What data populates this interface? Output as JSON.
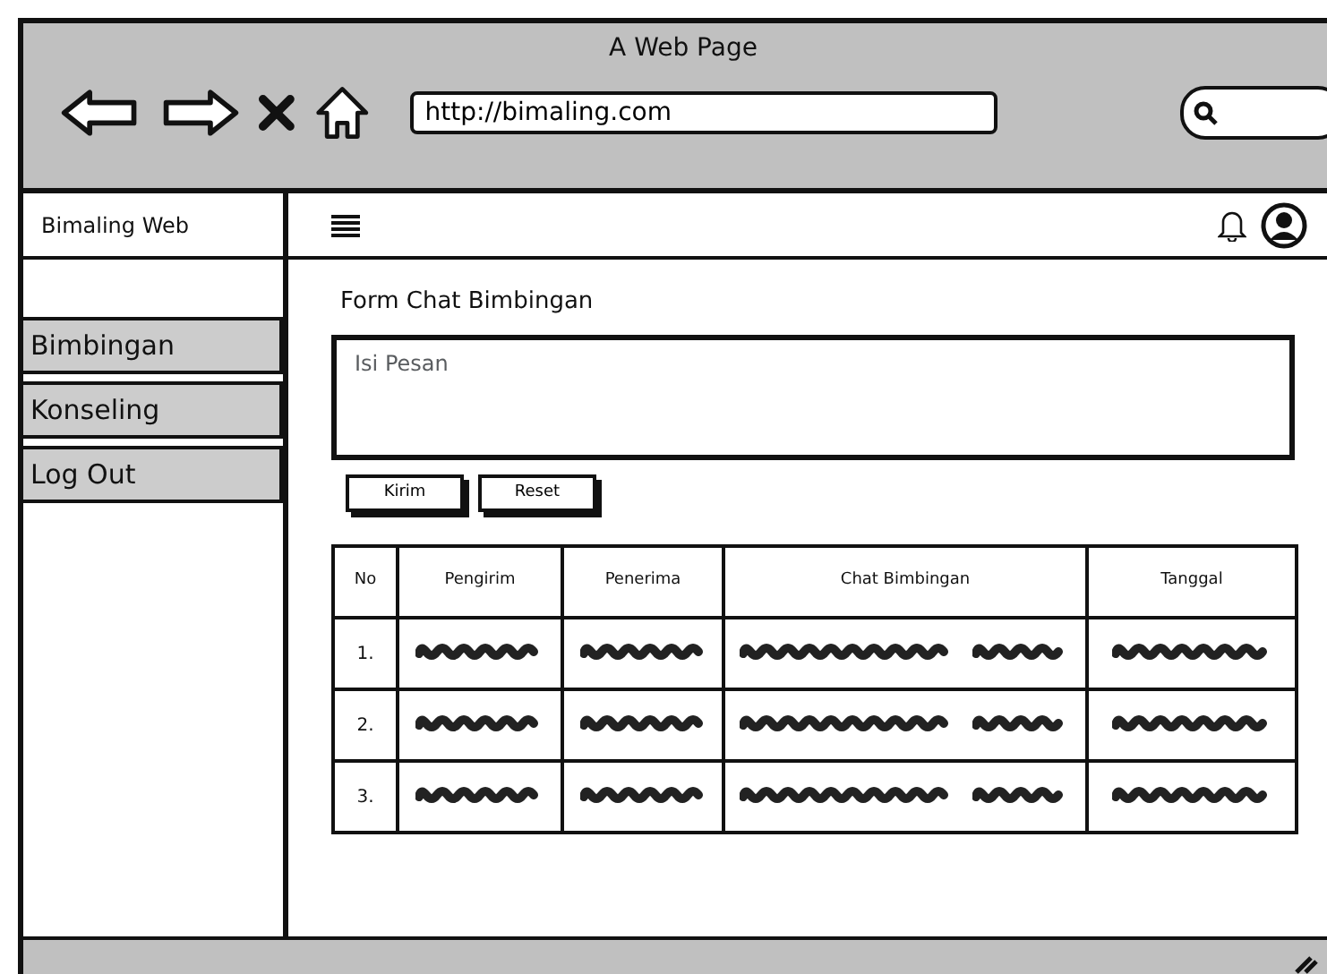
{
  "window": {
    "title": "A Web Page"
  },
  "address_bar": {
    "value": "http://bimaling.com"
  },
  "sidebar": {
    "brand": "Bimaling Web",
    "items": [
      {
        "label": "Bimbingan"
      },
      {
        "label": "Konseling"
      },
      {
        "label": "Log Out"
      }
    ]
  },
  "form": {
    "title": "Form Chat Bimbingan",
    "message_placeholder": "Isi Pesan",
    "buttons": [
      "Kirim",
      "Reset"
    ]
  },
  "table": {
    "columns": [
      "No",
      "Pengirim",
      "Penerima",
      "Chat Bimbingan",
      "Tanggal"
    ],
    "rows": [
      {
        "no": "1."
      },
      {
        "no": "2."
      },
      {
        "no": "3."
      }
    ]
  }
}
